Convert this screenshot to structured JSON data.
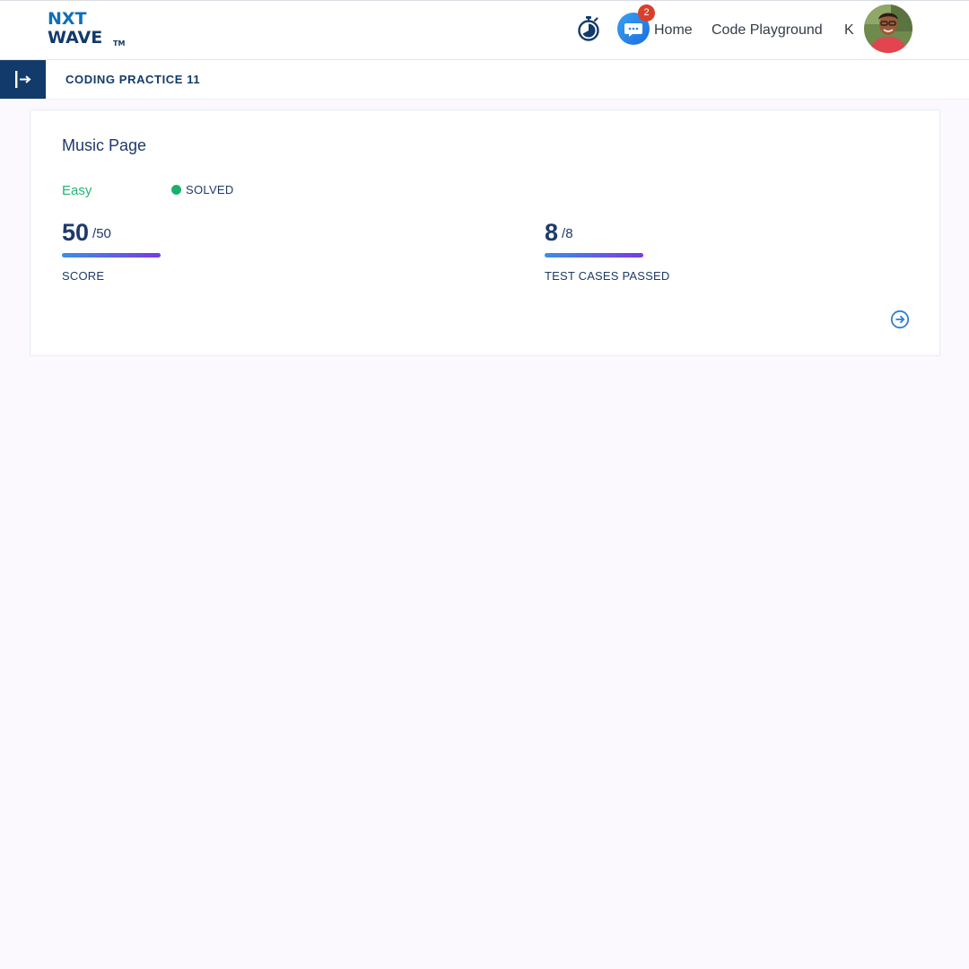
{
  "header": {
    "logo": {
      "line1": "NXT",
      "line2": "WAVE",
      "tm": "TM"
    },
    "chat_badge_count": "2",
    "nav": {
      "home": "Home",
      "code_playground": "Code Playground",
      "user_initial": "K"
    }
  },
  "subheader": {
    "title": "CODING PRACTICE 11"
  },
  "card": {
    "title": "Music Page",
    "difficulty": "Easy",
    "status": "SOLVED",
    "score": {
      "value": "50",
      "total": "/50",
      "label": "SCORE",
      "progress": 1.0
    },
    "tests": {
      "value": "8",
      "total": "/8",
      "label": "TEST CASES PASSED",
      "progress": 1.0
    }
  },
  "colors": {
    "brand_navy": "#123a6b",
    "brand_blue": "#0b6fbb",
    "easy_green": "#22b573",
    "solved_dot": "#16b26b",
    "badge_red": "#d9402b",
    "progress_start": "#3c8ee8",
    "progress_end": "#7a3ae6"
  },
  "icons": {
    "timer": "stopwatch-icon",
    "chat": "chat-bubble-icon",
    "sidebar_toggle": "expand-sidebar-icon",
    "open_problem": "circle-arrow-right-icon"
  }
}
